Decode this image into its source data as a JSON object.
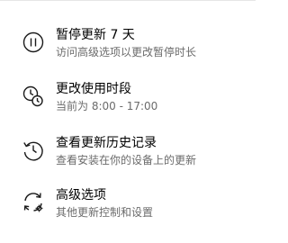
{
  "options": [
    {
      "icon": "pause-icon",
      "title": "暂停更新 7 天",
      "description": "访问高级选项以更改暂停时长"
    },
    {
      "icon": "clock-history-icon",
      "title": "更改使用时段",
      "description": "当前为 8:00 - 17:00"
    },
    {
      "icon": "history-icon",
      "title": "查看更新历史记录",
      "description": "查看安装在你的设备上的更新"
    },
    {
      "icon": "sync-settings-icon",
      "title": "高级选项",
      "description": "其他更新控制和设置"
    }
  ]
}
